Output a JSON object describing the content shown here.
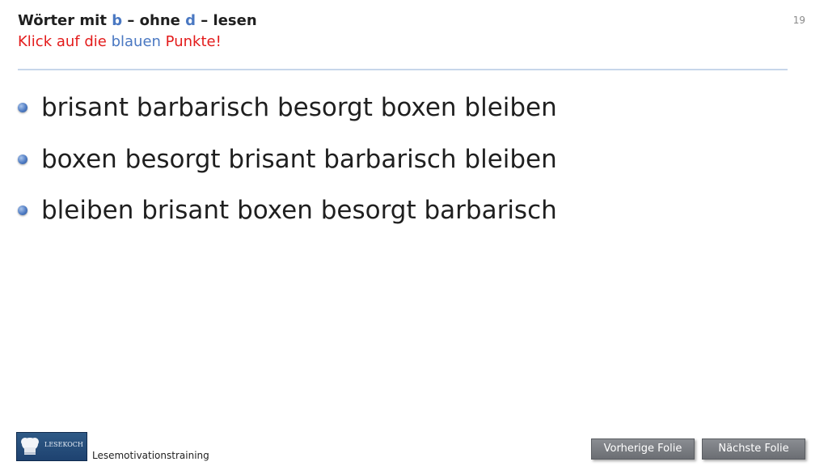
{
  "header": {
    "title_prefix": "Wörter mit ",
    "title_b": "b",
    "title_mid": " – ohne ",
    "title_d": "d",
    "title_suffix": " – lesen",
    "instruction_prefix": "Klick auf die ",
    "instruction_blue": "blauen",
    "instruction_suffix": " Punkte!",
    "slide_number": "19"
  },
  "bullets": [
    {
      "text": "brisant barbarisch besorgt boxen bleiben"
    },
    {
      "text": "boxen besorgt brisant barbarisch bleiben"
    },
    {
      "text": "bleiben brisant boxen besorgt barbarisch"
    }
  ],
  "footer": {
    "logo_text": "LESEKOCH",
    "label": "Lesemotivationstraining"
  },
  "navigation": {
    "prev_label": "Vorherige  Folie",
    "next_label": "Nächste  Folie"
  },
  "colors": {
    "accent_blue": "#4a78c2",
    "accent_red": "#e31b1b",
    "button_gray": "#7a7d82"
  }
}
